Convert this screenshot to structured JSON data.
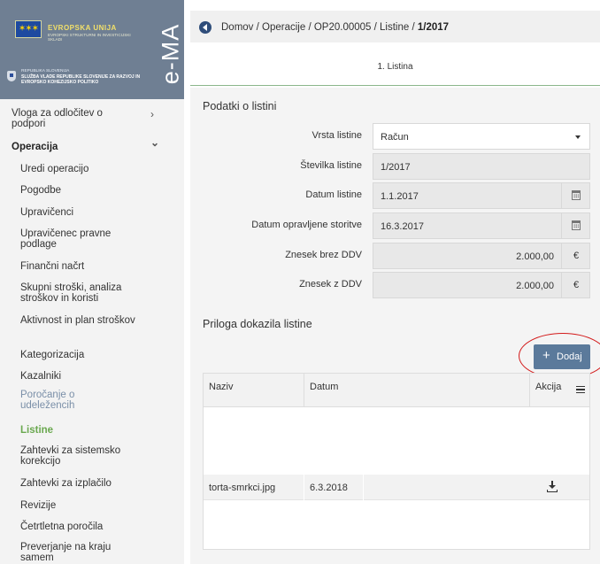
{
  "logo": {
    "eu_title": "EVROPSKA UNIJA",
    "eu_sub": "EVROPSKI STRUKTURNI IN INVESTICIJSKI SKLADI",
    "gov_small": "REPUBLIKA SLOVENIJA",
    "gov_text": "SLUŽBA VLADE REPUBLIKE SLOVENIJE ZA RAZVOJ IN EVROPSKO KOHEZIJSKO POLITIKO",
    "app_name": "e-MA"
  },
  "sidebar": {
    "items": [
      {
        "label": "Vloga za odločitev o podpori"
      },
      {
        "label": "Operacija"
      },
      {
        "label": "Uredi operacijo"
      },
      {
        "label": "Pogodbe"
      },
      {
        "label": "Upravičenci"
      },
      {
        "label": "Upravičenec pravne podlage"
      },
      {
        "label": "Finančni načrt"
      },
      {
        "label": "Skupni stroški, analiza stroškov in koristi"
      },
      {
        "label": "Aktivnost in plan stroškov"
      },
      {
        "label": "Kategorizacija"
      },
      {
        "label": "Kazalniki"
      },
      {
        "label": "Poročanje o udeležencih"
      },
      {
        "label": "Listine"
      },
      {
        "label": "Zahtevki za sistemsko korekcijo"
      },
      {
        "label": "Zahtevki za izplačilo"
      },
      {
        "label": "Revizije"
      },
      {
        "label": "Četrtletna poročila"
      },
      {
        "label": "Preverjanje na kraju samem"
      }
    ],
    "chev_right": "›",
    "chev_down": "⌄"
  },
  "breadcrumb": {
    "home": "Domov",
    "b1": "Operacije",
    "b2": "OP20.00005",
    "b3": "Listine",
    "current": "1/2017",
    "sep": " / "
  },
  "tab": {
    "label": "1. Listina"
  },
  "section1": {
    "title": "Podatki o listini",
    "fields": [
      {
        "label": "Vrsta listine",
        "value": "Račun"
      },
      {
        "label": "Številka listine",
        "value": "1/2017"
      },
      {
        "label": "Datum listine",
        "value": "1.1.2017"
      },
      {
        "label": "Datum opravljene storitve",
        "value": "16.3.2017"
      },
      {
        "label": "Znesek brez DDV",
        "value": "2.000,00"
      },
      {
        "label": "Znesek z DDV",
        "value": "2.000,00"
      }
    ],
    "currency": "€"
  },
  "section2": {
    "title": "Priloga dokazila listine",
    "add_label": "Dodaj",
    "add_icon": "+",
    "columns": [
      "Naziv",
      "Datum",
      "Akcija"
    ],
    "rows": [
      {
        "naziv": "torta-smrkci.jpg",
        "datum": "6.3.2018"
      }
    ]
  },
  "colors": {
    "sidebar_bg": "#f3f3f3",
    "logo_bg": "#6f7f93",
    "active_item": "#6aa84f",
    "button": "#5b7a9b",
    "highlight_ellipse": "#d31b1b"
  }
}
